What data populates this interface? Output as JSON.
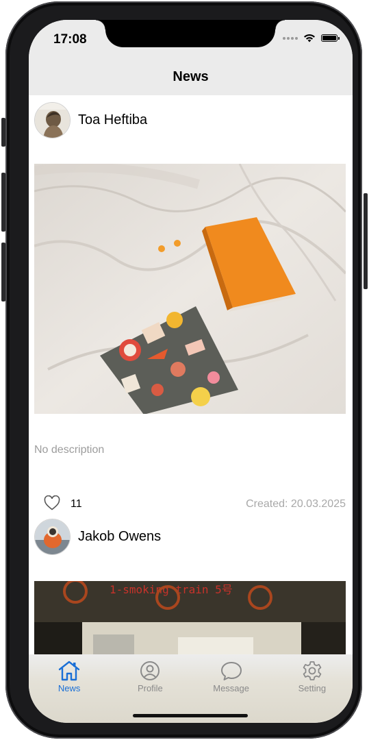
{
  "status": {
    "time": "17:08"
  },
  "nav": {
    "title": "News"
  },
  "posts": [
    {
      "author": "Toa Heftiba",
      "description": "No description",
      "likes": "11",
      "created": "Created: 20.03.2025"
    },
    {
      "author": "Jakob Owens",
      "image_text": "1-smoking train 5号"
    }
  ],
  "tabs": [
    {
      "label": "News",
      "icon": "home-icon",
      "active": true
    },
    {
      "label": "Profile",
      "icon": "profile-icon",
      "active": false
    },
    {
      "label": "Message",
      "icon": "message-icon",
      "active": false
    },
    {
      "label": "Setting",
      "icon": "gear-icon",
      "active": false
    }
  ],
  "colors": {
    "accent": "#1a6fd6",
    "inactive": "#8a8a8a",
    "muted_text": "#a8a8a8"
  }
}
